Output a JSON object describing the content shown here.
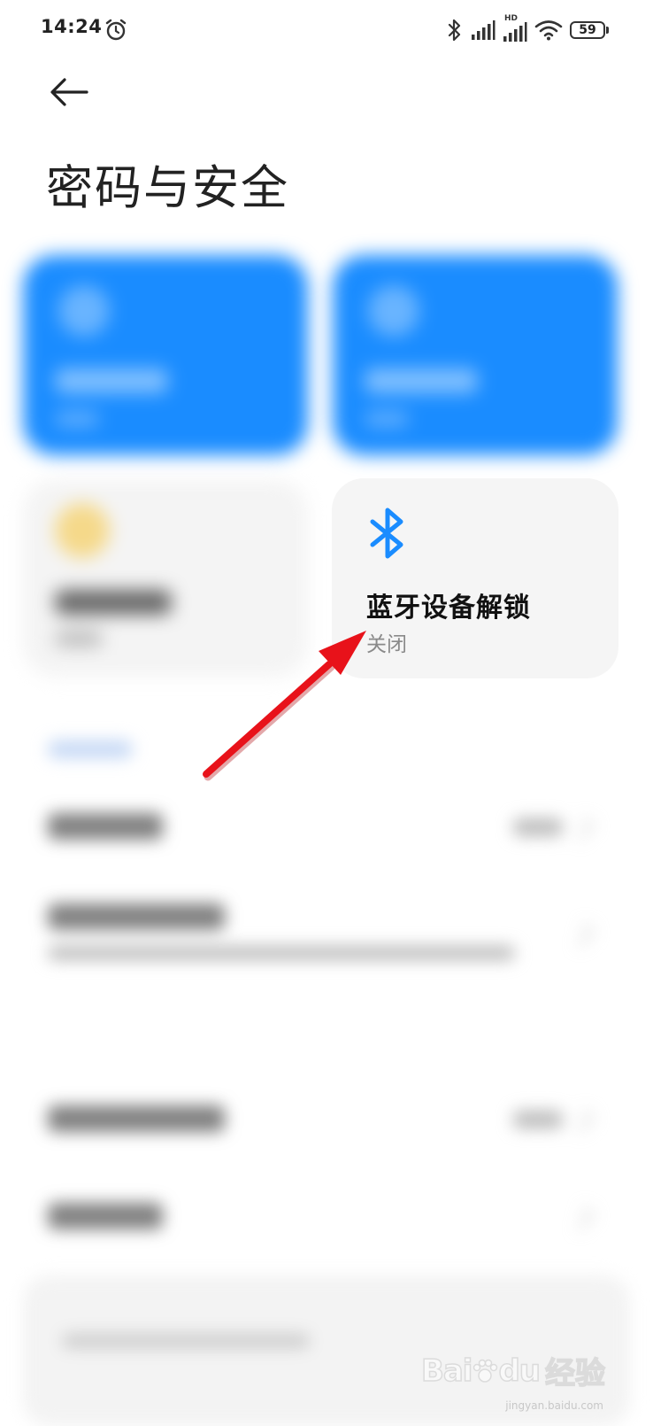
{
  "status_bar": {
    "time": "14:24",
    "hd_label": "HD",
    "battery_level": "59",
    "icons": [
      "alarm-icon",
      "bluetooth-icon",
      "signal-icon",
      "hd-signal-icon",
      "wifi-icon",
      "battery-icon"
    ]
  },
  "header": {
    "back_icon": "back-arrow-icon",
    "title": "密码与安全"
  },
  "bluetooth_unlock_card": {
    "icon": "bluetooth-icon",
    "title": "蓝牙设备解锁",
    "status": "关闭",
    "icon_color": "#1a8cff"
  },
  "colors": {
    "accent_blue": "#1a8cff",
    "card_gray": "#f5f5f5",
    "annotation_red": "#e8121a"
  },
  "watermark": {
    "logo": "Bai",
    "logo_du": "du",
    "cn": "经验",
    "url": "jingyan.baidu.com"
  }
}
